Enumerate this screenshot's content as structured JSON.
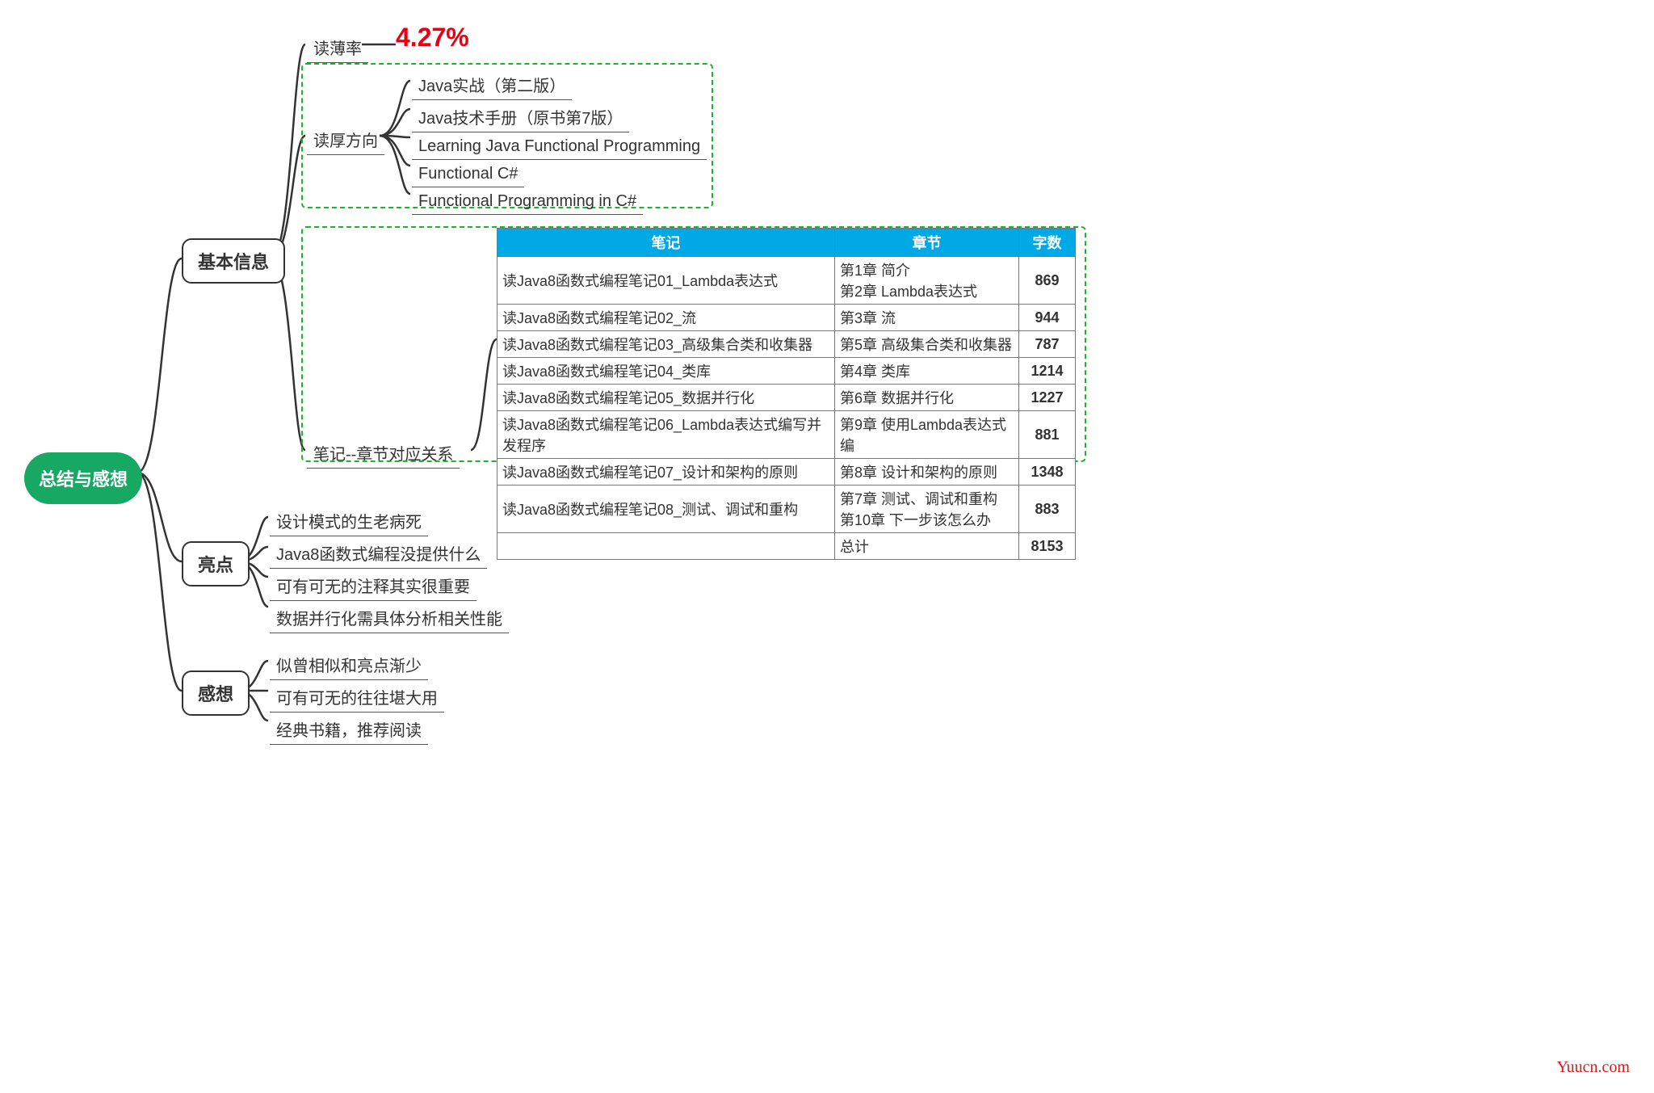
{
  "root": {
    "label": "总结与感想"
  },
  "branches": {
    "basic_info": {
      "label": "基本信息"
    },
    "thin_rate": {
      "label": "读薄率",
      "value": "4.27%"
    },
    "thick_dir": {
      "label": "读厚方向"
    },
    "notes_map": {
      "label": "笔记--章节对应关系"
    },
    "highlights": {
      "label": "亮点"
    },
    "thoughts": {
      "label": "感想"
    }
  },
  "thick_books": [
    "Java实战（第二版）",
    "Java技术手册（原书第7版）",
    "Learning Java Functional Programming",
    "Functional C#",
    "Functional Programming in C#"
  ],
  "highlight_items": [
    "设计模式的生老病死",
    "Java8函数式编程没提供什么",
    "可有可无的注释其实很重要",
    "数据并行化需具体分析相关性能"
  ],
  "thought_items": [
    "似曾相似和亮点渐少",
    "可有可无的往往堪大用",
    "经典书籍，推荐阅读"
  ],
  "table": {
    "headers": [
      "笔记",
      "章节",
      "字数"
    ],
    "rows": [
      {
        "note": "读Java8函数式编程笔记01_Lambda表达式",
        "chapter": "第1章  简介\n第2章  Lambda表达式",
        "count": "869"
      },
      {
        "note": "读Java8函数式编程笔记02_流",
        "chapter": "第3章  流",
        "count": "944"
      },
      {
        "note": "读Java8函数式编程笔记03_高级集合类和收集器",
        "chapter": "第5章  高级集合类和收集器",
        "count": "787"
      },
      {
        "note": "读Java8函数式编程笔记04_类库",
        "chapter": "第4章  类库",
        "count": "1214"
      },
      {
        "note": "读Java8函数式编程笔记05_数据并行化",
        "chapter": "第6章  数据并行化",
        "count": "1227"
      },
      {
        "note": "读Java8函数式编程笔记06_Lambda表达式编写并发程序",
        "chapter": "第9章  使用Lambda表达式编",
        "count": "881"
      },
      {
        "note": "读Java8函数式编程笔记07_设计和架构的原则",
        "chapter": "第8章  设计和架构的原则",
        "count": "1348"
      },
      {
        "note": "读Java8函数式编程笔记08_测试、调试和重构",
        "chapter": "第7章  测试、调试和重构\n第10章  下一步该怎么办",
        "count": "883"
      }
    ],
    "total": {
      "note": "",
      "chapter": "总计",
      "count": "8153"
    }
  },
  "watermark": "Yuucn.com"
}
